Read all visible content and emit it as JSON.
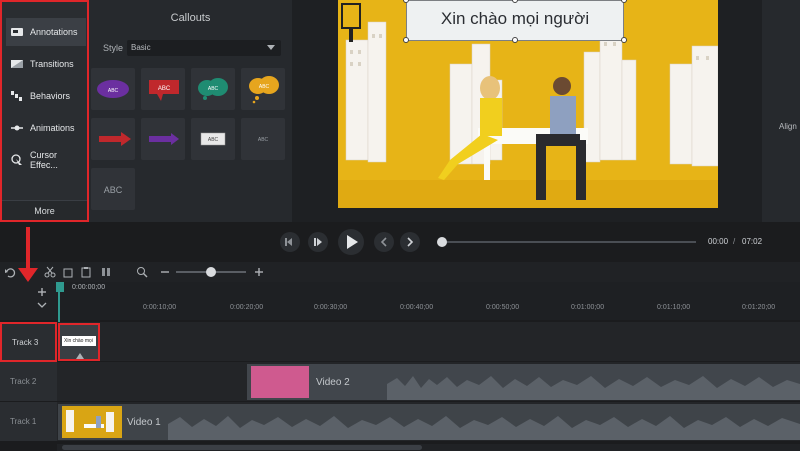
{
  "tools": {
    "items": [
      {
        "label": "Annotations",
        "icon": "annotations-icon"
      },
      {
        "label": "Transitions",
        "icon": "transitions-icon"
      },
      {
        "label": "Behaviors",
        "icon": "behaviors-icon"
      },
      {
        "label": "Animations",
        "icon": "animations-icon"
      },
      {
        "label": "Cursor Effec...",
        "icon": "cursor-effects-icon"
      }
    ],
    "more_label": "More"
  },
  "callouts": {
    "title": "Callouts",
    "style_label": "Style",
    "style_value": "Basic",
    "tiles": [
      {
        "text": "ABC",
        "color": "#6b2fa0"
      },
      {
        "text": "ABC",
        "color": "#c0282c"
      },
      {
        "text": "ABC",
        "color": "#1f8c72"
      },
      {
        "text": "ABC",
        "color": "#e6a51e"
      },
      {
        "text": "",
        "color": "#c0282c"
      },
      {
        "text": "",
        "color": "#6b2fa0"
      },
      {
        "text": "ABC",
        "color": "#e8e8e8"
      },
      {
        "text": "ABC",
        "color": "#303338"
      },
      {
        "text": "ABC",
        "color": "#303338"
      }
    ]
  },
  "preview": {
    "callout_text": "Xin chào mọi người"
  },
  "properties": {
    "align_label": "Align"
  },
  "playback": {
    "current_time": "00:00",
    "separator": "/",
    "total_time": "07:02",
    "progress": 0
  },
  "timeline": {
    "playhead_time": "0:00:00;00",
    "ruler_ticks": [
      "0:00:10;00",
      "0:00:20;00",
      "0:00:30;00",
      "0:00:40;00",
      "0:00:50;00",
      "0:01:00;00",
      "0:01:10;00",
      "0:01:20;00"
    ],
    "tracks": [
      {
        "name": "Track 3",
        "clip_label": "Xin chào mọi"
      },
      {
        "name": "Track 2",
        "clip_label": "Video 2"
      },
      {
        "name": "Track 1",
        "clip_label": "Video 1"
      }
    ]
  },
  "colors": {
    "highlight": "#e0262a",
    "video_bg": "#e7b417",
    "panel": "#2a2d31"
  }
}
